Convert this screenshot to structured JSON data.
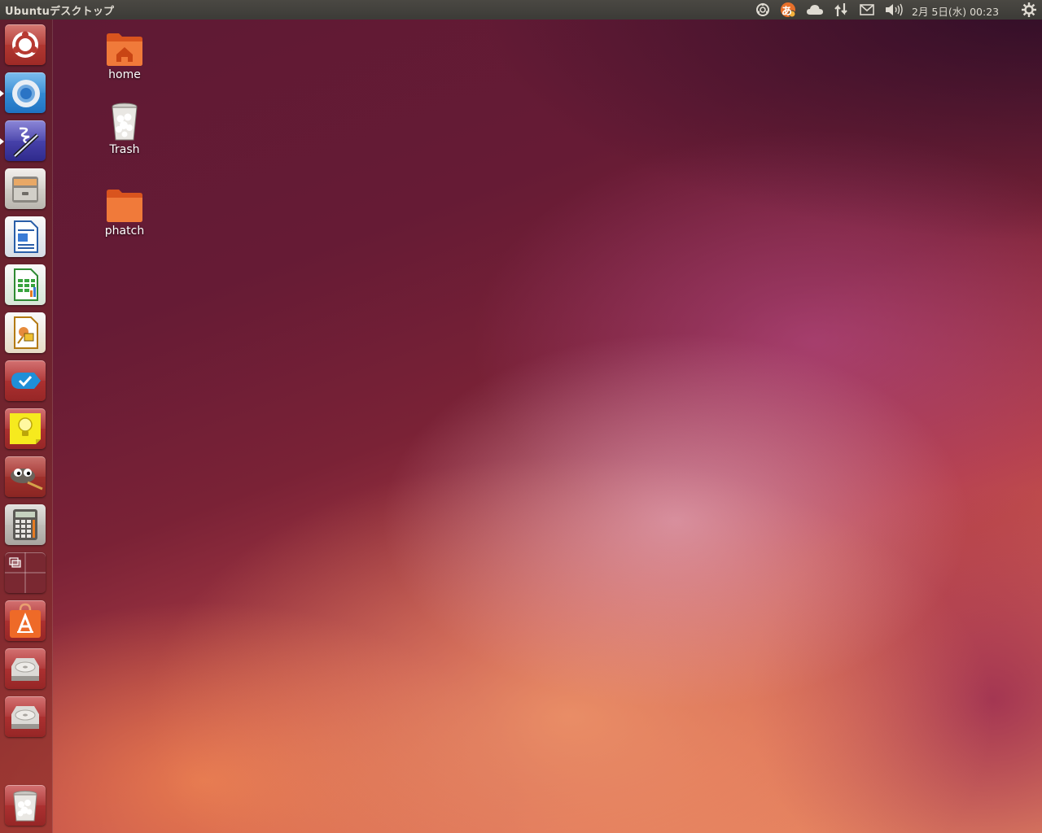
{
  "panel": {
    "title": "Ubuntuデスクトップ",
    "clock": "2月 5日(水) 00:23",
    "tray_icons": [
      "ubuntu-one-icon",
      "input-method-icon",
      "cloud-icon",
      "network-icon",
      "mail-icon",
      "volume-icon",
      "session-gear-icon"
    ],
    "input_method_char": "あ"
  },
  "launcher": {
    "items": [
      {
        "name": "dash-home",
        "icon": "ubuntu-logo-icon",
        "running": false
      },
      {
        "name": "chromium",
        "icon": "chromium-icon",
        "running": true
      },
      {
        "name": "emacs",
        "icon": "emacs-icon",
        "running": true
      },
      {
        "name": "files",
        "icon": "file-cabinet-icon",
        "running": false
      },
      {
        "name": "libreoffice-writer",
        "icon": "writer-icon",
        "running": false
      },
      {
        "name": "libreoffice-calc",
        "icon": "calc-icon",
        "running": false
      },
      {
        "name": "libreoffice-impress",
        "icon": "impress-icon",
        "running": false
      },
      {
        "name": "tasks",
        "icon": "checkmark-icon",
        "running": false
      },
      {
        "name": "tomboy-notes",
        "icon": "lightbulb-note-icon",
        "running": false
      },
      {
        "name": "gimp",
        "icon": "gimp-icon",
        "running": false
      },
      {
        "name": "calculator",
        "icon": "calculator-icon",
        "running": false
      },
      {
        "name": "workspace-switcher",
        "icon": "workspace-icon",
        "running": false
      },
      {
        "name": "software-center",
        "icon": "software-center-icon",
        "running": false
      },
      {
        "name": "drive-1",
        "icon": "hard-drive-icon",
        "running": false
      },
      {
        "name": "drive-2",
        "icon": "hard-drive-icon",
        "running": false
      },
      {
        "name": "trash",
        "icon": "trash-icon",
        "running": false
      }
    ]
  },
  "desktop": {
    "icons": [
      {
        "label": "home",
        "icon": "home-folder-icon"
      },
      {
        "label": "Trash",
        "icon": "trash-icon"
      },
      {
        "label": "phatch",
        "icon": "folder-icon"
      }
    ]
  },
  "colors": {
    "panel_bg": "#3c3b37",
    "panel_text": "#dfdbd2",
    "ubuntu_orange": "#dd4814",
    "folder_orange": "#f06a2a"
  }
}
